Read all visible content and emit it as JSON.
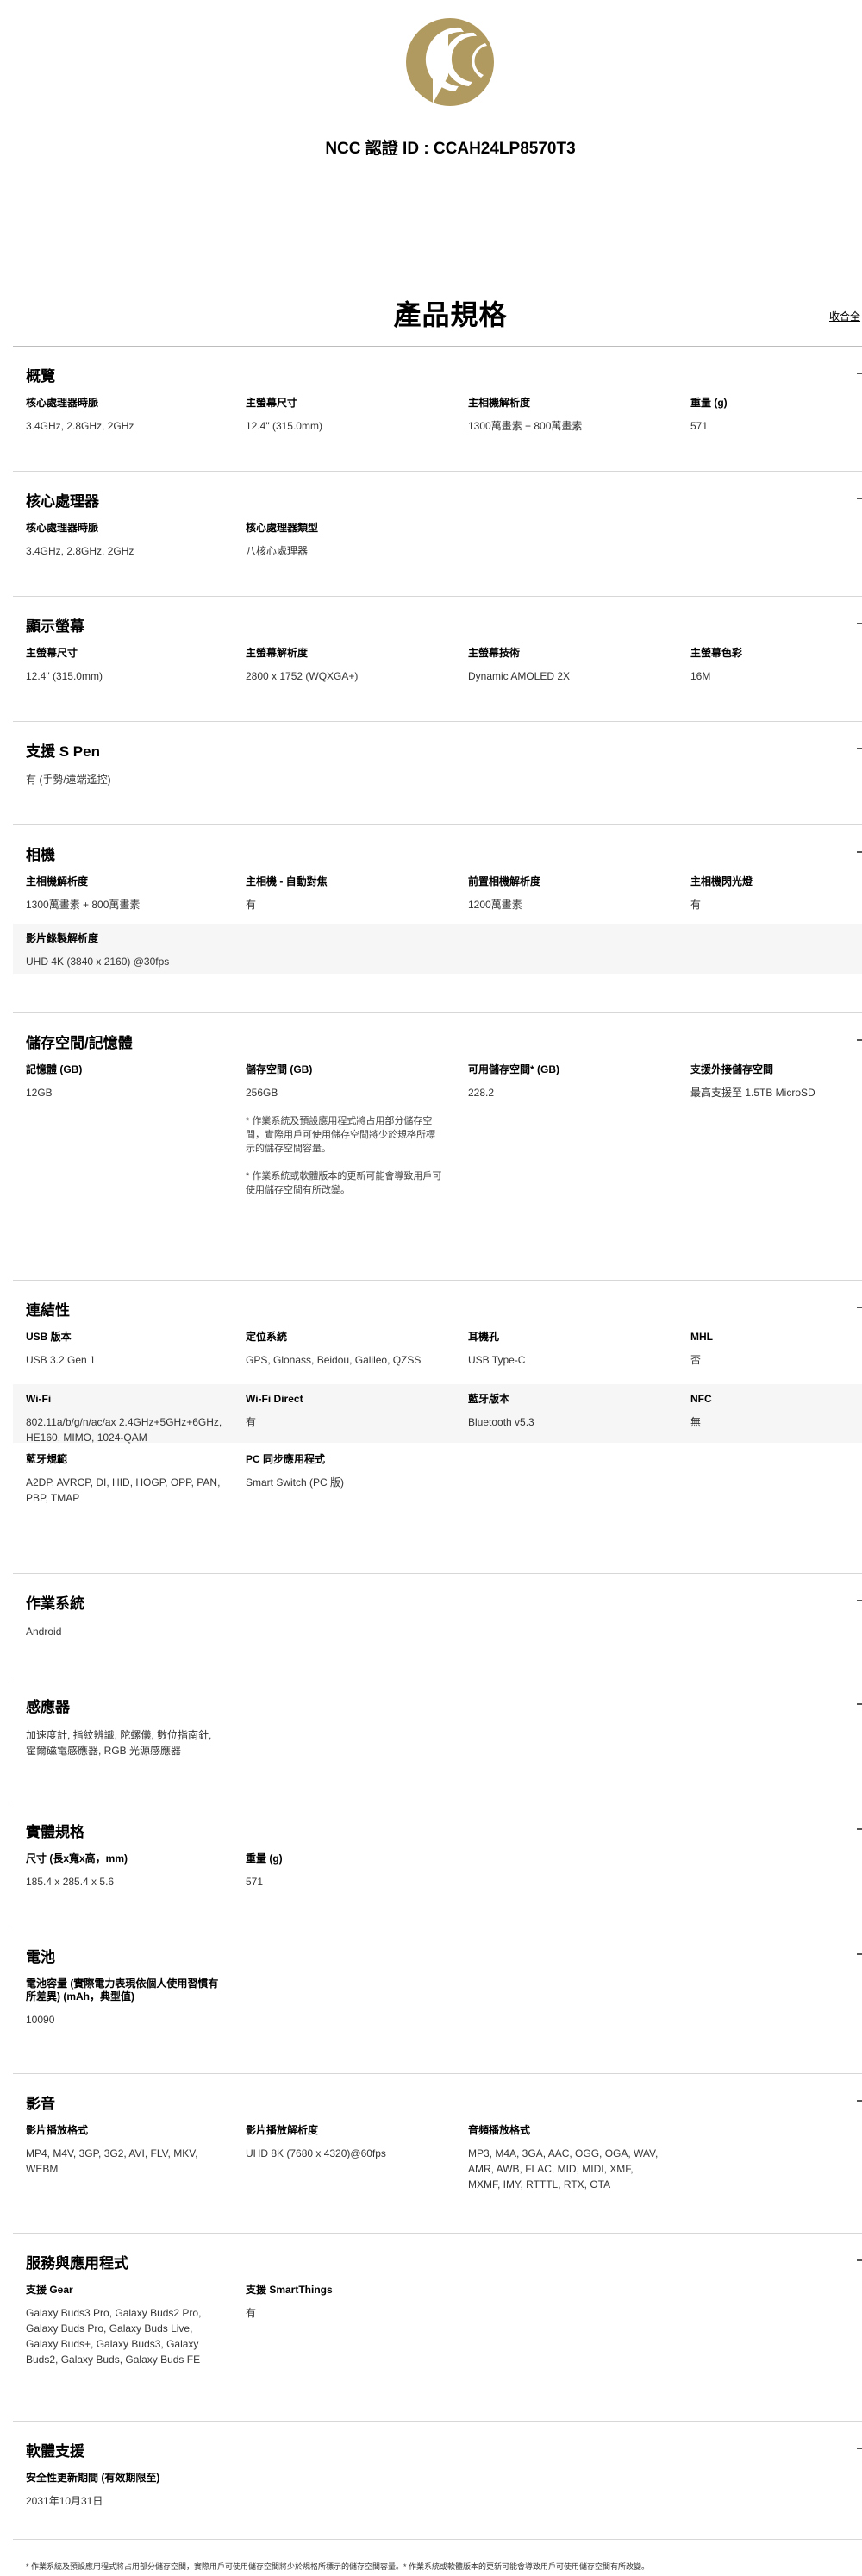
{
  "ncc": {
    "id_text": "NCC 認證 ID : CCAH24LP8570T3"
  },
  "page": {
    "title": "產品規格",
    "collapse_all": "收合全"
  },
  "sections": [
    {
      "title": "概覽",
      "rows": [
        {
          "cells": [
            {
              "label": "核心處理器時脈",
              "value": "3.4GHz, 2.8GHz, 2GHz"
            },
            {
              "label": "主螢幕尺寸",
              "value": "12.4\" (315.0mm)"
            },
            {
              "label": "主相機解析度",
              "value": "1300萬畫素 + 800萬畫素"
            },
            {
              "label": "重量 (g)",
              "value": "571"
            }
          ]
        }
      ]
    },
    {
      "title": "核心處理器",
      "rows": [
        {
          "cells": [
            {
              "label": "核心處理器時脈",
              "value": "3.4GHz, 2.8GHz, 2GHz"
            },
            {
              "label": "核心處理器類型",
              "value": "八核心處理器"
            }
          ]
        }
      ]
    },
    {
      "title": "顯示螢幕",
      "rows": [
        {
          "cells": [
            {
              "label": "主螢幕尺寸",
              "value": "12.4\" (315.0mm)"
            },
            {
              "label": "主螢幕解析度",
              "value": "2800 x 1752 (WQXGA+)"
            },
            {
              "label": "主螢幕技術",
              "value": "Dynamic AMOLED 2X"
            },
            {
              "label": "主螢幕色彩",
              "value": "16M"
            }
          ]
        }
      ]
    },
    {
      "title": "支援 S Pen",
      "rows": [
        {
          "cells": [
            {
              "label": "",
              "value": "有 (手勢/遠端遙控)"
            }
          ]
        }
      ]
    },
    {
      "title": "相機",
      "rows": [
        {
          "cells": [
            {
              "label": "主相機解析度",
              "value": "1300萬畫素 + 800萬畫素"
            },
            {
              "label": "主相機 - 自動對焦",
              "value": "有"
            },
            {
              "label": "前置相機解析度",
              "value": "1200萬畫素"
            },
            {
              "label": "主相機閃光燈",
              "value": "有"
            }
          ]
        },
        {
          "cells": [
            {
              "label": "影片錄製解析度",
              "value": "UHD 4K (3840 x 2160) @30fps"
            }
          ]
        }
      ]
    },
    {
      "title": "儲存空間/記憶體",
      "rows": [
        {
          "cells": [
            {
              "label": "記憶體 (GB)",
              "value": "12GB"
            },
            {
              "label": "儲存空間 (GB)",
              "value": "256GB",
              "notes": [
                "* 作業系統及預設應用程式將占用部分儲存空間，實際用戶可使用儲存空間將少於規格所標示的儲存空間容量。",
                "* 作業系統或軟體版本的更新可能會導致用戶可使用儲存空間有所改變。"
              ]
            },
            {
              "label": "可用儲存空間* (GB)",
              "value": "228.2"
            },
            {
              "label": "支援外接儲存空間",
              "value": "最高支援至 1.5TB MicroSD"
            }
          ]
        }
      ]
    },
    {
      "title": "連結性",
      "rows": [
        {
          "cells": [
            {
              "label": "USB 版本",
              "value": "USB 3.2 Gen 1"
            },
            {
              "label": "定位系統",
              "value": "GPS, Glonass, Beidou, Galileo, QZSS"
            },
            {
              "label": "耳機孔",
              "value": "USB Type-C"
            },
            {
              "label": "MHL",
              "value": "否"
            }
          ]
        },
        {
          "cells": [
            {
              "label": "Wi-Fi",
              "value": "802.11a/b/g/n/ac/ax 2.4GHz+5GHz+6GHz, HE160, MIMO, 1024-QAM"
            },
            {
              "label": "Wi-Fi Direct",
              "value": "有"
            },
            {
              "label": "藍牙版本",
              "value": "Bluetooth v5.3"
            },
            {
              "label": "NFC",
              "value": "無"
            }
          ]
        },
        {
          "cells": [
            {
              "label": "藍牙規範",
              "value": "A2DP, AVRCP, DI, HID, HOGP, OPP, PAN, PBP, TMAP"
            },
            {
              "label": "PC 同步應用程式",
              "value": "Smart Switch (PC 版)"
            }
          ]
        }
      ]
    },
    {
      "title": "作業系統",
      "rows": [
        {
          "cells": [
            {
              "label": "",
              "value": "Android"
            }
          ]
        }
      ]
    },
    {
      "title": "感應器",
      "rows": [
        {
          "cells": [
            {
              "label": "",
              "value": "加速度計, 指紋辨識, 陀螺儀, 數位指南針, 霍爾磁電感應器, RGB 光源感應器"
            }
          ]
        }
      ]
    },
    {
      "title": "實體規格",
      "rows": [
        {
          "cells": [
            {
              "label": "尺寸 (長x寬x高，mm)",
              "value": "185.4 x 285.4 x 5.6"
            },
            {
              "label": "重量 (g)",
              "value": "571"
            }
          ]
        }
      ]
    },
    {
      "title": "電池",
      "rows": [
        {
          "cells": [
            {
              "label": "電池容量 (實際電力表現依個人使用習慣有所差異) (mAh，典型值)",
              "value": "10090"
            }
          ]
        }
      ]
    },
    {
      "title": "影音",
      "rows": [
        {
          "cells": [
            {
              "label": "影片播放格式",
              "value": "MP4, M4V, 3GP, 3G2, AVI, FLV, MKV, WEBM"
            },
            {
              "label": "影片播放解析度",
              "value": "UHD 8K (7680 x 4320)@60fps"
            },
            {
              "label": "音頻播放格式",
              "value": "MP3, M4A, 3GA, AAC, OGG, OGA, WAV, AMR, AWB, FLAC, MID, MIDI, XMF, MXMF, IMY, RTTTL, RTX, OTA"
            }
          ]
        }
      ]
    },
    {
      "title": "服務與應用程式",
      "rows": [
        {
          "cells": [
            {
              "label": "支援 Gear",
              "value": "Galaxy Buds3 Pro, Galaxy Buds2 Pro, Galaxy Buds Pro, Galaxy Buds Live, Galaxy Buds+, Galaxy Buds3, Galaxy Buds2, Galaxy Buds, Galaxy Buds FE"
            },
            {
              "label": "支援 SmartThings",
              "value": "有"
            }
          ]
        }
      ]
    },
    {
      "title": "軟體支援",
      "rows": [
        {
          "cells": [
            {
              "label": "安全性更新期間 (有效期限至)",
              "value": "2031年10月31日"
            }
          ]
        }
      ]
    }
  ],
  "footnote": "* 作業系統及預設應用程式將占用部分儲存空間，實際用戶可使用儲存空間將少於規格所標示的儲存空間容量。* 作業系統或軟體版本的更新可能會導致用戶可使用儲存空間有所改變。",
  "colors": {
    "logo_gold": "#b19a5f",
    "divider": "#d7d7d7",
    "shaded_row": "#f6f6f6"
  },
  "icons": {
    "logo": "ncc-logo-icon",
    "section_toggle": "minus-icon"
  }
}
